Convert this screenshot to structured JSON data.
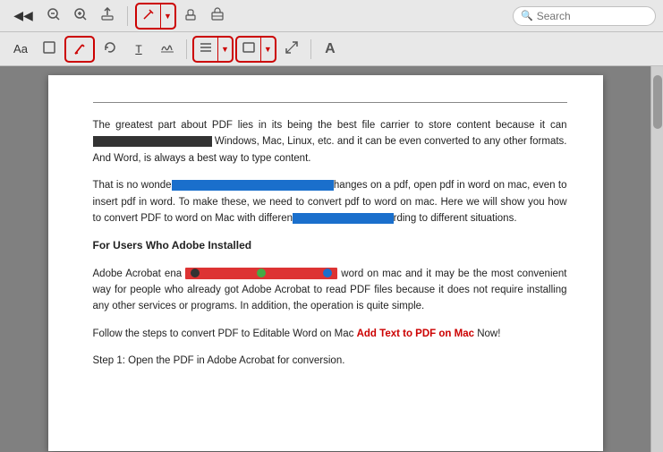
{
  "toolbar_top": {
    "nav_prev_label": "◀",
    "nav_dropdown_label": "▼",
    "zoom_out_label": "－",
    "zoom_in_label": "＋",
    "export_label": "⬆",
    "pen_label": "✏",
    "pen_dropdown_label": "▼",
    "stamp_label": "🔒",
    "briefcase_label": "💼",
    "search_placeholder": "Search"
  },
  "toolbar_second": {
    "text_size_label": "Aa",
    "checkbox_label": "☐",
    "pen_red_label": "/",
    "rotate_label": "↻",
    "correction_label": "T̲",
    "signature_label": "✍",
    "sep1": "|",
    "align_label": "≡",
    "align_dropdown": "▼",
    "rect_label": "▭",
    "rect_dropdown": "▼",
    "resize_label": "⤢",
    "font_label": "A"
  },
  "content": {
    "para1": "The greatest part about PDF lies in its being the best file carrier to store content because it can",
    "para1_hidden": "                                                    ",
    "para1_end": "Windows, Mac, Linux, etc. and it can be even converted to any other formats. And Word, is always a best way to type content.",
    "para2_start": "That is no wonde",
    "para2_highlight": "                                                   ",
    "para2_mid": "hanges on a pdf, open pdf in word on mac, even to insert pdf in word. To make these, we need to convert pdf to word on mac. Here we will show you how to convert PDF to word on Mac with differen",
    "para2_highlight2": "                            ",
    "para2_end": "rding to different situations.",
    "heading": "For Users Who Adobe Installed",
    "para3_start": "Adobe Acrobat ena",
    "para3_redbar": "                              ",
    "para3_end": "word on mac and it may be the most convenient way for people who already got Adobe Acrobat to read PDF files because it does not require installing any other services or programs. In addition, the operation is quite simple.",
    "para4_start": "Follow the steps to convert PDF to Editable Word on Mac ",
    "para4_link": "Add Text to PDF on Mac",
    "para4_end": " Now!",
    "para5": "Step 1: Open the PDF in Adobe Acrobat for conversion."
  }
}
